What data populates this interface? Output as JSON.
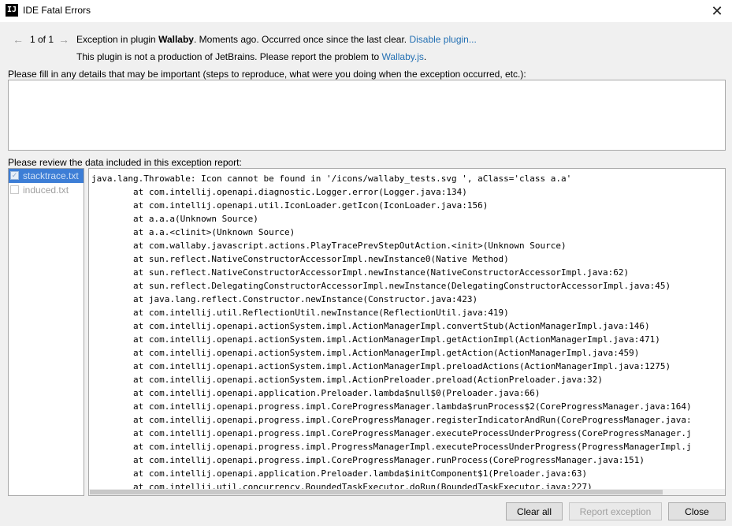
{
  "window": {
    "title": "IDE Fatal Errors",
    "app_icon_text": "IJ",
    "close_glyph": "✕"
  },
  "navigation": {
    "prev_glyph": "←",
    "next_glyph": "→",
    "counter": "1 of 1"
  },
  "message": {
    "prefix": "Exception in plugin ",
    "plugin_name": "Wallaby",
    "suffix": ". Moments ago. Occurred once since the last clear. ",
    "disable_link": "Disable plugin...",
    "report_prefix": "This plugin is not a production of JetBrains. Please report the problem to ",
    "report_link": "Wallaby.js",
    "report_suffix": "."
  },
  "details": {
    "label": "Please fill in any details that may be important (steps to reproduce, what were you doing when the exception occurred, etc.):",
    "value": "",
    "placeholder": ""
  },
  "review": {
    "label": "Please review the data included in this exception report:",
    "files": [
      {
        "name": "stacktrace.txt",
        "selected": true,
        "checked": true
      },
      {
        "name": "induced.txt",
        "selected": false,
        "checked": false
      }
    ]
  },
  "stacktrace": {
    "lines": [
      "java.lang.Throwable: Icon cannot be found in '/icons/wallaby_tests.svg ', aClass='class a.a'",
      "\tat com.intellij.openapi.diagnostic.Logger.error(Logger.java:134)",
      "\tat com.intellij.openapi.util.IconLoader.getIcon(IconLoader.java:156)",
      "\tat a.a.a(Unknown Source)",
      "\tat a.a.<clinit>(Unknown Source)",
      "\tat com.wallaby.javascript.actions.PlayTracePrevStepOutAction.<init>(Unknown Source)",
      "\tat sun.reflect.NativeConstructorAccessorImpl.newInstance0(Native Method)",
      "\tat sun.reflect.NativeConstructorAccessorImpl.newInstance(NativeConstructorAccessorImpl.java:62)",
      "\tat sun.reflect.DelegatingConstructorAccessorImpl.newInstance(DelegatingConstructorAccessorImpl.java:45)",
      "\tat java.lang.reflect.Constructor.newInstance(Constructor.java:423)",
      "\tat com.intellij.util.ReflectionUtil.newInstance(ReflectionUtil.java:419)",
      "\tat com.intellij.openapi.actionSystem.impl.ActionManagerImpl.convertStub(ActionManagerImpl.java:146)",
      "\tat com.intellij.openapi.actionSystem.impl.ActionManagerImpl.getActionImpl(ActionManagerImpl.java:471)",
      "\tat com.intellij.openapi.actionSystem.impl.ActionManagerImpl.getAction(ActionManagerImpl.java:459)",
      "\tat com.intellij.openapi.actionSystem.impl.ActionManagerImpl.preloadActions(ActionManagerImpl.java:1275)",
      "\tat com.intellij.openapi.actionSystem.impl.ActionPreloader.preload(ActionPreloader.java:32)",
      "\tat com.intellij.openapi.application.Preloader.lambda$null$0(Preloader.java:66)",
      "\tat com.intellij.openapi.progress.impl.CoreProgressManager.lambda$runProcess$2(CoreProgressManager.java:164)",
      "\tat com.intellij.openapi.progress.impl.CoreProgressManager.registerIndicatorAndRun(CoreProgressManager.java:",
      "\tat com.intellij.openapi.progress.impl.CoreProgressManager.executeProcessUnderProgress(CoreProgressManager.j",
      "\tat com.intellij.openapi.progress.impl.ProgressManagerImpl.executeProcessUnderProgress(ProgressManagerImpl.j",
      "\tat com.intellij.openapi.progress.impl.CoreProgressManager.runProcess(CoreProgressManager.java:151)",
      "\tat com.intellij.openapi.application.Preloader.lambda$initComponent$1(Preloader.java:63)",
      "\tat com.intellij.util.concurrency.BoundedTaskExecutor.doRun(BoundedTaskExecutor.java:227)"
    ]
  },
  "buttons": {
    "clear_all": "Clear all",
    "report_exception": "Report exception",
    "close": "Close"
  }
}
